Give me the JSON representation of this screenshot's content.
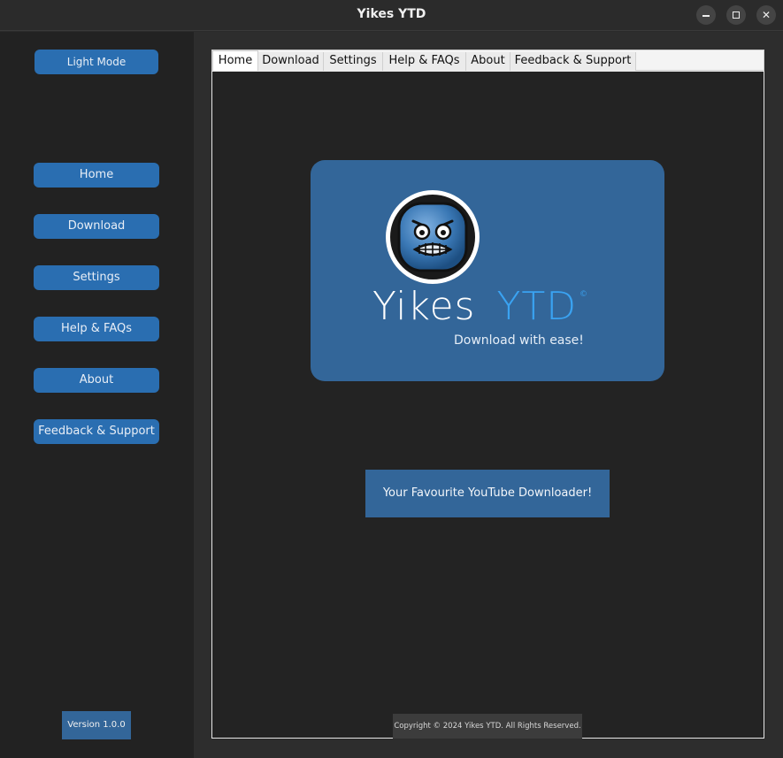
{
  "window": {
    "title": "Yikes YTD",
    "controls": [
      "minimize-icon",
      "maximize-icon",
      "close-icon"
    ],
    "close_glyph": "✕"
  },
  "sidebar": {
    "theme_toggle_label": "Light Mode",
    "items": [
      {
        "label": "Home"
      },
      {
        "label": "Download"
      },
      {
        "label": "Settings"
      },
      {
        "label": "Help & FAQs"
      },
      {
        "label": "About"
      },
      {
        "label": "Feedback & Support"
      }
    ],
    "version_label": "Version 1.0.0"
  },
  "tabs": [
    {
      "label": "Home",
      "active": true
    },
    {
      "label": "Download",
      "active": false
    },
    {
      "label": "Settings",
      "active": false
    },
    {
      "label": "Help & FAQs",
      "active": false
    },
    {
      "label": "About",
      "active": false
    },
    {
      "label": "Feedback & Support",
      "active": false
    }
  ],
  "home": {
    "logo_icon": "grimace-face-icon",
    "brand_word1": "Yikes",
    "brand_word2": "YTD",
    "brand_mark": "©",
    "tagline": "Download with ease!",
    "slogan": "Your Favourite YouTube Downloader!",
    "copyright": "Copyright © 2024 Yikes YTD. All Rights Reserved."
  },
  "colors": {
    "sidebar_button": "#2a6eb1",
    "hero_background": "#336699",
    "brand_accent": "#3aa3f2",
    "panel_background": "#232323",
    "window_background": "#2b2b2b"
  }
}
